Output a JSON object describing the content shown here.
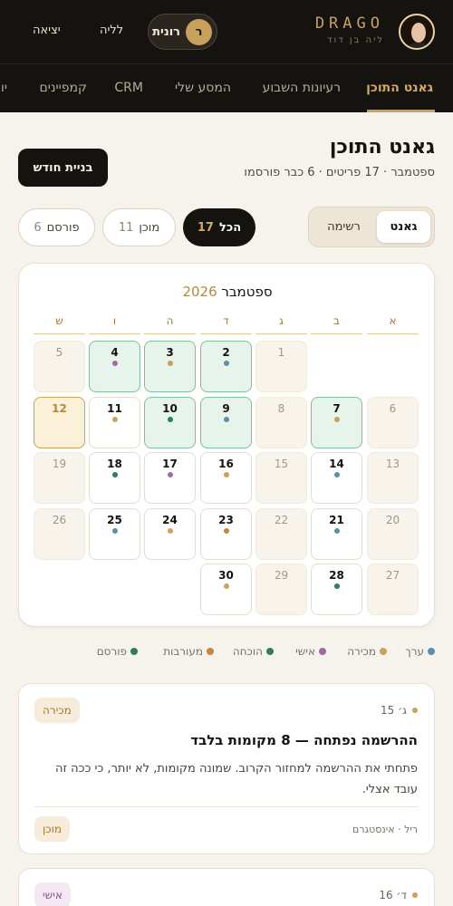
{
  "brand": {
    "logo": "DRAGO",
    "subtitle": "ליה בן דוד"
  },
  "user": {
    "initial": "ר",
    "name": "רונית"
  },
  "header_actions": {
    "night": "לליה",
    "logout": "יציאה"
  },
  "nav": {
    "tabs": [
      {
        "label": "גאנט התוכן",
        "active": true
      },
      {
        "label": "רעיונות השבוע"
      },
      {
        "label": "המסע שלי"
      },
      {
        "label": "CRM"
      },
      {
        "label": "קמפיינים"
      },
      {
        "label": "יו"
      }
    ]
  },
  "page": {
    "title": "גאנט התוכן",
    "subtitle": "ספטמבר · 17 פריטים · 6 כבר פורסמו",
    "new_month_button": "בניית חודש"
  },
  "view_toggle": {
    "gantt": "גאנט",
    "list": "רשימה",
    "selected": "gantt"
  },
  "filters": [
    {
      "label": "הכל",
      "count": "17",
      "selected": true
    },
    {
      "label": "מוכן",
      "count": "11"
    },
    {
      "label": "פורסם",
      "count": "6"
    }
  ],
  "calendar": {
    "month": "ספטמבר",
    "year": "2026",
    "weekdays": [
      "א",
      "ב",
      "ג",
      "ד",
      "ה",
      "ו",
      "ש"
    ],
    "weeks": [
      [
        null,
        null,
        {
          "day": "1"
        },
        {
          "day": "2",
          "dot": "value",
          "status": "published"
        },
        {
          "day": "3",
          "dot": "sale",
          "status": "published"
        },
        {
          "day": "4",
          "dot": "personal",
          "status": "published"
        },
        {
          "day": "5"
        }
      ],
      [
        {
          "day": "6"
        },
        {
          "day": "7",
          "dot": "sale",
          "status": "published"
        },
        {
          "day": "8"
        },
        {
          "day": "9",
          "dot": "value",
          "status": "published"
        },
        {
          "day": "10",
          "dot": "proof",
          "status": "published"
        },
        {
          "day": "11",
          "dot": "sale",
          "status": "ready"
        },
        {
          "day": "12",
          "status": "today"
        }
      ],
      [
        {
          "day": "13"
        },
        {
          "day": "14",
          "dot": "value",
          "status": "ready"
        },
        {
          "day": "15"
        },
        {
          "day": "16",
          "dot": "sale",
          "status": "ready"
        },
        {
          "day": "17",
          "dot": "personal",
          "status": "ready"
        },
        {
          "day": "18",
          "dot": "proof",
          "status": "ready"
        },
        {
          "day": "19"
        }
      ],
      [
        {
          "day": "20"
        },
        {
          "day": "21",
          "dot": "value",
          "status": "ready"
        },
        {
          "day": "22"
        },
        {
          "day": "23",
          "dot": "engagement",
          "status": "ready"
        },
        {
          "day": "24",
          "dot": "sale",
          "status": "ready"
        },
        {
          "day": "25",
          "dot": "value",
          "status": "ready"
        },
        {
          "day": "26"
        }
      ],
      [
        {
          "day": "27"
        },
        {
          "day": "28",
          "dot": "proof",
          "status": "ready"
        },
        {
          "day": "29"
        },
        {
          "day": "30",
          "dot": "sale",
          "status": "ready"
        },
        null,
        null,
        null
      ]
    ]
  },
  "legend": [
    {
      "key": "value",
      "label": "ערך",
      "color": "#5b8fb0"
    },
    {
      "key": "sale",
      "label": "מכירה",
      "color": "#c9a15a"
    },
    {
      "key": "personal",
      "label": "אישי",
      "color": "#a06aa8"
    },
    {
      "key": "proof",
      "label": "הוכחה",
      "color": "#2e7d5b"
    },
    {
      "key": "engagement",
      "label": "מעורבות",
      "color": "#c8843c"
    },
    {
      "key": "published",
      "label": "פורסם",
      "color": "#2e7d5b"
    }
  ],
  "posts": [
    {
      "date": "ג׳ 15",
      "tag": "מכירה",
      "title": "ההרשמה נפתחה — 8 מקומות בלבד",
      "body": "פתחתי את ההרשמה למחזור הקרוב. שמונה מקומות, לא יותר, כי ככה זה עובד אצלי.",
      "meta": "ריל · אינסטגרם",
      "status": "מוכן"
    },
    {
      "date": "ד׳ 16",
      "tag": "אישי"
    }
  ]
}
